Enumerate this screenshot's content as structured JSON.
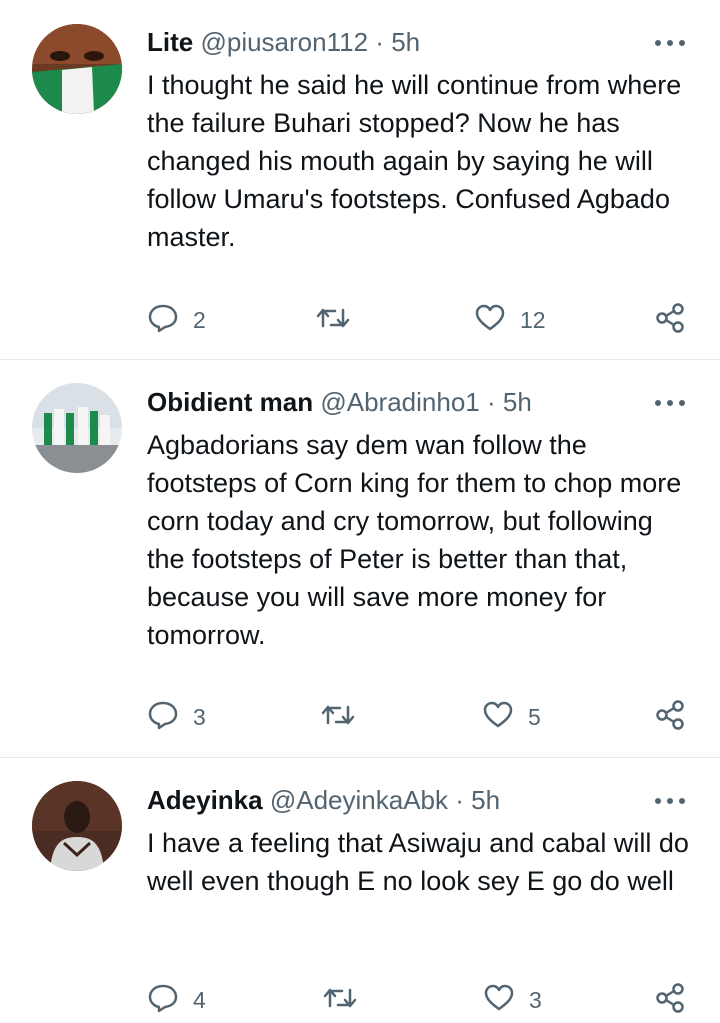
{
  "tweets": [
    {
      "name": "Lite",
      "handle": "@piusaron112",
      "separator": "·",
      "time": "5h",
      "text": "I thought he said he will continue from where the failure Buhari stopped? Now he has changed his mouth again by saying he will follow Umaru's footsteps. Confused Agbado master.",
      "replies": "2",
      "likes": "12"
    },
    {
      "name": "Obidient man",
      "handle": "@Abradinho1",
      "separator": "·",
      "time": "5h",
      "text": "Agbadorians say dem wan follow the footsteps of Corn king for them to chop more corn today and cry tomorrow, but following the footsteps of Peter is better than that, because you will save more money for tomorrow.",
      "replies": "3",
      "likes": "5"
    },
    {
      "name": "Adeyinka",
      "handle": "@AdeyinkaAbk",
      "separator": "·",
      "time": "5h",
      "text": "I have a feeling that Asiwaju and cabal will do well even though E no look sey E go do well",
      "replies": "4",
      "likes": "3"
    }
  ],
  "icons": {
    "reply": "reply-icon",
    "retweet": "retweet-icon",
    "like": "heart-icon",
    "share": "share-icon",
    "more": "more-icon"
  },
  "colors": {
    "text": "#0f1419",
    "secondary": "#536471",
    "divider": "#e6e9eb"
  }
}
